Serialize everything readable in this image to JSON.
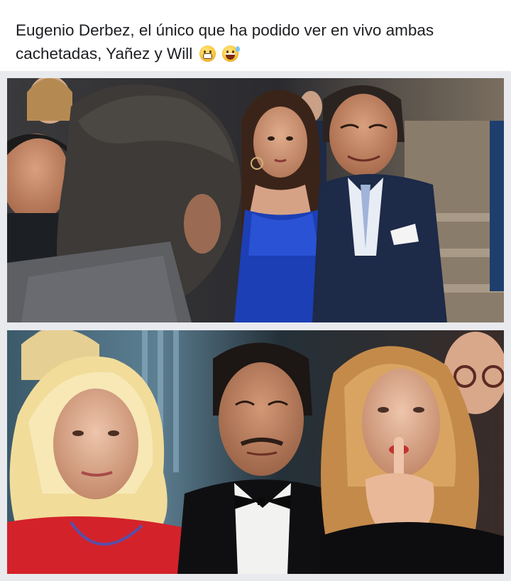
{
  "post": {
    "caption": "Eugenio Derbez, el único que ha podido ver en vivo ambas cachetadas, Yañez y Will",
    "emojis": [
      "grimacing-face-emoji",
      "grinning-sweat-face-emoji"
    ]
  },
  "images": {
    "top": {
      "description": "photo"
    },
    "bottom": {
      "description": "photo"
    }
  },
  "colors": {
    "background": "#ffffff",
    "caption_text": "#1c1e21",
    "media_backdrop": "#e8eaee"
  }
}
